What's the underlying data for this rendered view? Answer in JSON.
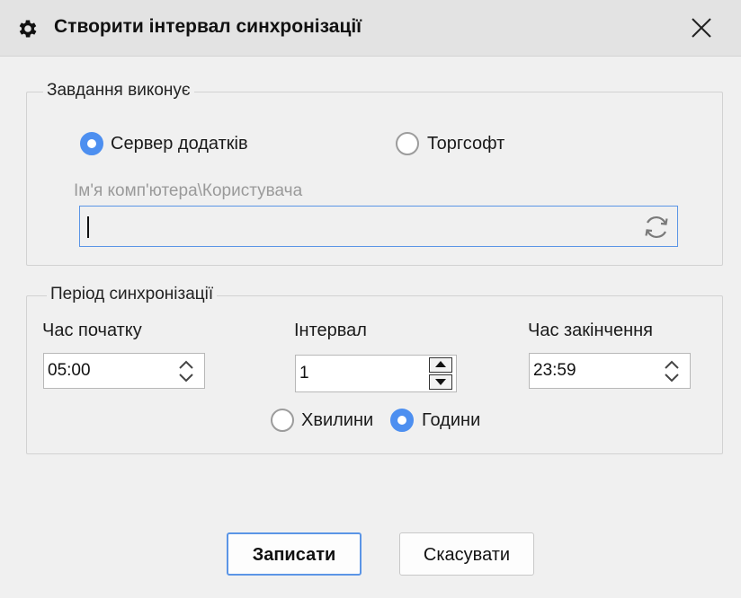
{
  "window": {
    "title": "Створити інтервал синхронізації",
    "icons": {
      "title": "gear-icon",
      "close": "close-icon"
    }
  },
  "executor_group": {
    "legend": "Завдання виконує",
    "options": [
      {
        "label": "Сервер додатків",
        "checked": true
      },
      {
        "label": "Торгсофт",
        "checked": false
      }
    ],
    "computer_user": {
      "label": "Ім'я комп'ютера\\Користувача",
      "value": "",
      "refresh_icon": "refresh-icon"
    }
  },
  "period_group": {
    "legend": "Період синхронізації",
    "start": {
      "label": "Час початку",
      "value": "05:00"
    },
    "interval": {
      "label": "Інтервал",
      "value": "1"
    },
    "end": {
      "label": "Час закінчення",
      "value": "23:59"
    },
    "units": [
      {
        "label": "Хвилини",
        "checked": false
      },
      {
        "label": "Години",
        "checked": true
      }
    ]
  },
  "buttons": {
    "save": "Записати",
    "cancel": "Скасувати"
  },
  "colors": {
    "accent": "#4d8ff0",
    "focus_border": "#5b95e6"
  }
}
